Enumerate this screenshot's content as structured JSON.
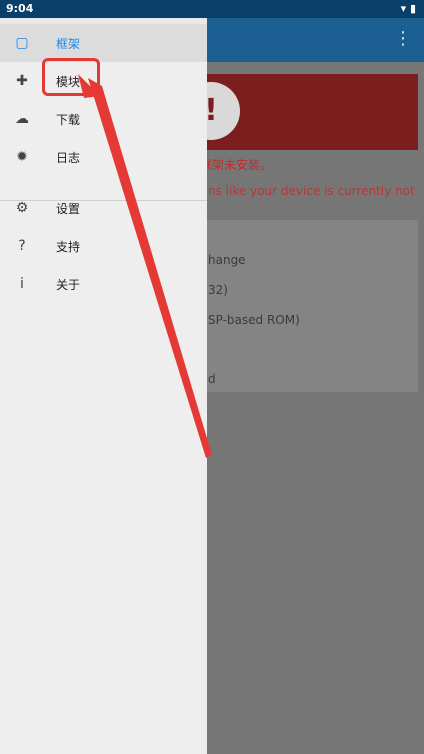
{
  "status": {
    "time": "9:04",
    "icons": "▾ ▮"
  },
  "appbar": {
    "more": "⋮"
  },
  "background": {
    "red_alert": "!",
    "red_text": "框架未安装。",
    "red_text2": "ns like your device is currently not",
    "lines": [
      "hange",
      "32)",
      "SP-based ROM)",
      "d"
    ]
  },
  "drawer": {
    "items": [
      {
        "label": "框架",
        "icon": "▢"
      },
      {
        "label": "模块",
        "icon": "✚"
      },
      {
        "label": "下载",
        "icon": "☁"
      },
      {
        "label": "日志",
        "icon": "✹"
      },
      {
        "label": "设置",
        "icon": "⚙"
      },
      {
        "label": "支持",
        "icon": "?"
      },
      {
        "label": "关于",
        "icon": "i"
      }
    ]
  }
}
